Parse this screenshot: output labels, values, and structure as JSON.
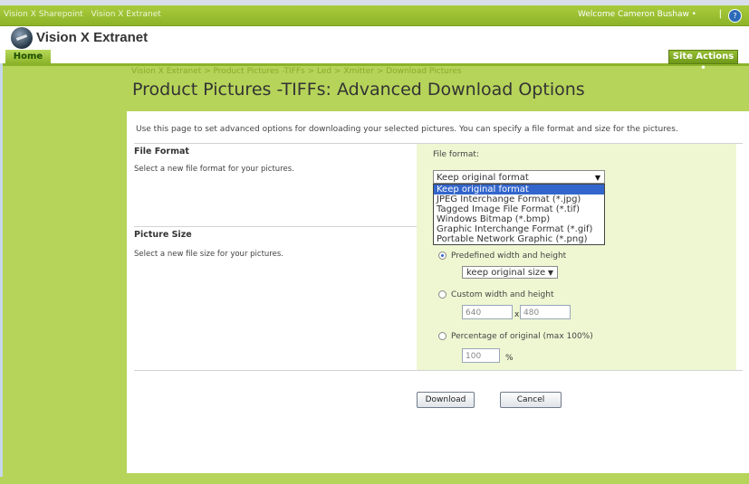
{
  "topbar": {
    "crumbs": [
      "Vision X Sharepoint",
      "Vision X Extranet"
    ],
    "welcome": "Welcome Cameron Bushaw •",
    "divider": "|"
  },
  "site": {
    "title": "Vision X Extranet"
  },
  "nav": {
    "home": "Home",
    "site_actions": "Site Actions •"
  },
  "breadcrumb": "Vision X Extranet > Product Pictures -TIFFs > Led > Xmitter > Download Pictures",
  "page_title": "Product Pictures -TIFFs: Advanced Download Options",
  "intro": "Use this page to set advanced options for downloading your selected pictures. You can specify a file format and size for the pictures.",
  "file_format": {
    "title": "File Format",
    "description": "Select a new file format for your pictures.",
    "label": "File format:",
    "selected": "Keep original format",
    "options": [
      "Keep original format",
      "JPEG Interchange Format (*.jpg)",
      "Tagged Image File Format (*.tif)",
      "Windows Bitmap (*.bmp)",
      "Graphic Interchange Format (*.gif)",
      "Portable Network Graphic (*.png)"
    ]
  },
  "picture_size": {
    "title": "Picture Size",
    "description": "Select a new file size for your pictures.",
    "predefined_label": "Predefined width and height",
    "predefined_value": "keep original size",
    "custom_label": "Custom width and height",
    "width_value": "640",
    "x_label": "x",
    "height_value": "480",
    "percentage_label": "Percentage of original (max 100%)",
    "percent_value": "100",
    "percent_unit": "%"
  },
  "buttons": {
    "download": "Download",
    "cancel": "Cancel"
  }
}
